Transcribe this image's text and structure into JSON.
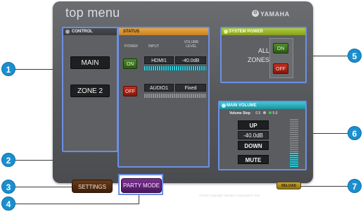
{
  "header": {
    "title": "top menu",
    "brand": "YAMAHA"
  },
  "control": {
    "header": "CONTROL",
    "buttons": [
      "MAIN",
      "ZONE 2"
    ]
  },
  "status": {
    "header": "STATUS",
    "columns": {
      "power": "POWER",
      "input": "INPUT",
      "volume": "VOLUME LEVEL"
    },
    "rows": [
      {
        "power": "ON",
        "input": "HDMI1",
        "volume": "-40.0dB",
        "level": 0.8
      },
      {
        "power": "OFF",
        "input": "AUDIO1",
        "volume": "Fixed",
        "level": 0
      }
    ]
  },
  "system_power": {
    "header": "SYSTEM POWER",
    "label_line1": "ALL",
    "label_line2": "ZONES",
    "on": "ON",
    "off": "OFF"
  },
  "main_volume": {
    "header": "MAIN VOLUME",
    "step_label": "Volume Step",
    "step_option_1": "0.5",
    "step_option_2": "5.0",
    "up": "UP",
    "value": "-40.0dB",
    "down": "DOWN",
    "mute": "MUTE",
    "level": 0.3
  },
  "footer": {
    "settings": "SETTINGS",
    "party_mode": "PARTY MODE",
    "reload": "RELOAD",
    "copyright": "©2010 Copyright Yamaha Corporation Visit",
    "website": "www.yamaha.com"
  },
  "callouts": [
    "1",
    "2",
    "3",
    "4",
    "5",
    "6",
    "7"
  ],
  "colors": {
    "accent_border": "#6c8fe6",
    "callout": "#1b8fcf",
    "on": "#4f8d2c",
    "off": "#c2301d",
    "meter": "#2ad0e0"
  }
}
